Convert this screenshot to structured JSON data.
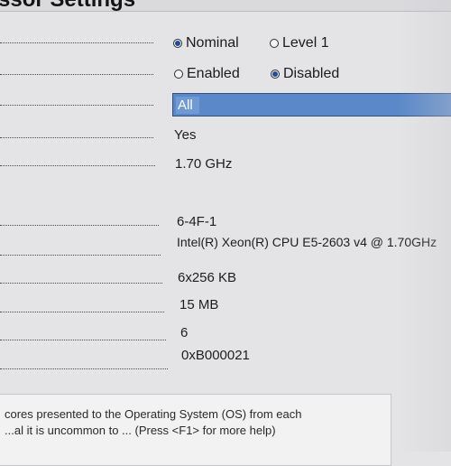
{
  "header": {
    "title": "ssor Settings"
  },
  "settings": {
    "row1": {
      "options": [
        {
          "label": "Nominal",
          "selected": true
        },
        {
          "label": "Level 1",
          "selected": false
        }
      ]
    },
    "row2": {
      "options": [
        {
          "label": "Enabled",
          "selected": false
        },
        {
          "label": "Disabled",
          "selected": true
        }
      ]
    },
    "row3": {
      "selected": "All"
    },
    "row4": {
      "value": "Yes"
    },
    "row5": {
      "value": "1.70 GHz"
    },
    "row6": {
      "value": "6-4F-1"
    },
    "row7": {
      "value": "Intel(R) Xeon(R) CPU E5-2603 v4 @ 1.70GHz"
    },
    "row8": {
      "value": "6x256 KB"
    },
    "row9": {
      "value": "15 MB"
    },
    "row10": {
      "value": "6"
    },
    "row11": {
      "value": "0xB000021"
    }
  },
  "help": {
    "line1": "cores presented to the Operating System (OS) from each",
    "line2": "...al it is uncommon to ... (Press <F1> for more help)"
  },
  "colors": {
    "selection": "#5a88c8",
    "radio_dot": "#1d4e9a",
    "background": "#e4e4e6"
  }
}
